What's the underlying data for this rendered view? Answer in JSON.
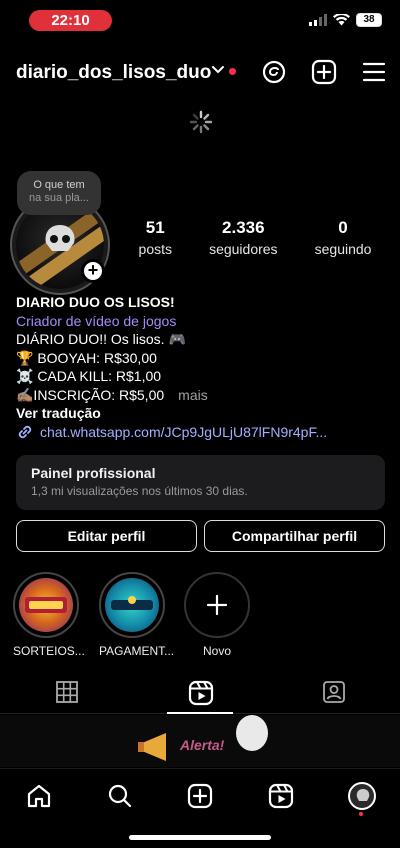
{
  "status_bar": {
    "time": "22:10",
    "battery": "38"
  },
  "header": {
    "username": "diario_dos_lisos_duo",
    "icons": [
      "threads-icon",
      "create-icon",
      "menu-icon"
    ]
  },
  "profile": {
    "note_line1": "O que tem",
    "note_line2": "na sua pla...",
    "stats": [
      {
        "value": "51",
        "label": "posts"
      },
      {
        "value": "2.336",
        "label": "seguidores"
      },
      {
        "value": "0",
        "label": "seguindo"
      }
    ]
  },
  "bio": {
    "name": "DIARIO DUO OS LISOS!",
    "category": "Criador de vídeo de jogos",
    "line1": "DIÁRIO DUO!! Os lisos. 🎮",
    "line2": "🏆 BOOYAH: R$30,00",
    "line3": "☠️ CADA KILL: R$1,00",
    "line4": "✍🏽INSCRIÇÃO: R$5,00",
    "more": "mais",
    "translate": "Ver tradução",
    "link": "chat.whatsapp.com/JCp9JgULjU87lFN9r4pF..."
  },
  "dashboard": {
    "title": "Painel profissional",
    "subtitle": "1,3 mi visualizações nos últimos 30 dias."
  },
  "buttons": {
    "edit": "Editar perfil",
    "share": "Compartilhar perfil"
  },
  "highlights": [
    {
      "label": "SORTEIOS..."
    },
    {
      "label": "PAGAMENT..."
    },
    {
      "label": "Novo"
    }
  ],
  "tabs": [
    "grid-icon",
    "reels-icon",
    "tagged-icon"
  ],
  "promo": {
    "text": "Alerta!"
  },
  "bottom_nav": [
    "home-icon",
    "search-icon",
    "create-icon",
    "reels-icon",
    "profile-avatar"
  ],
  "colors": {
    "accent_purple": "#a78bfa",
    "link_blue": "#a3b0ff",
    "notify_red": "#ff2d55",
    "status_red": "#e0303a"
  }
}
